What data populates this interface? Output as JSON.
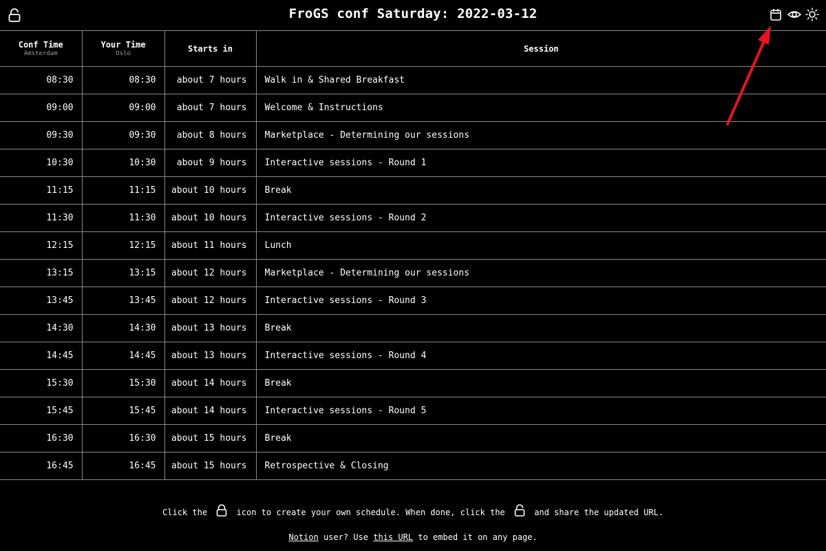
{
  "header": {
    "title": "FroGS conf Saturday: 2022-03-12",
    "icons": [
      "lock-icon",
      "calendar-icon",
      "eye-icon",
      "sun-icon"
    ]
  },
  "table": {
    "columns": {
      "conf_time": "Conf Time",
      "conf_time_sub": "Amsterdam",
      "your_time": "Your Time",
      "your_time_sub": "Oslo",
      "starts_in": "Starts in",
      "session": "Session"
    },
    "rows": [
      {
        "conf": "08:30",
        "your": "08:30",
        "starts": "about 7 hours",
        "session": "Walk in & Shared Breakfast"
      },
      {
        "conf": "09:00",
        "your": "09:00",
        "starts": "about 7 hours",
        "session": "Welcome & Instructions"
      },
      {
        "conf": "09:30",
        "your": "09:30",
        "starts": "about 8 hours",
        "session": "Marketplace - Determining our sessions"
      },
      {
        "conf": "10:30",
        "your": "10:30",
        "starts": "about 9 hours",
        "session": "Interactive sessions - Round 1"
      },
      {
        "conf": "11:15",
        "your": "11:15",
        "starts": "about 10 hours",
        "session": "Break"
      },
      {
        "conf": "11:30",
        "your": "11:30",
        "starts": "about 10 hours",
        "session": "Interactive sessions - Round 2"
      },
      {
        "conf": "12:15",
        "your": "12:15",
        "starts": "about 11 hours",
        "session": "Lunch"
      },
      {
        "conf": "13:15",
        "your": "13:15",
        "starts": "about 12 hours",
        "session": "Marketplace - Determining our sessions"
      },
      {
        "conf": "13:45",
        "your": "13:45",
        "starts": "about 12 hours",
        "session": "Interactive sessions - Round 3"
      },
      {
        "conf": "14:30",
        "your": "14:30",
        "starts": "about 13 hours",
        "session": "Break"
      },
      {
        "conf": "14:45",
        "your": "14:45",
        "starts": "about 13 hours",
        "session": "Interactive sessions - Round 4"
      },
      {
        "conf": "15:30",
        "your": "15:30",
        "starts": "about 14 hours",
        "session": "Break"
      },
      {
        "conf": "15:45",
        "your": "15:45",
        "starts": "about 14 hours",
        "session": "Interactive sessions - Round 5"
      },
      {
        "conf": "16:30",
        "your": "16:30",
        "starts": "about 15 hours",
        "session": "Break"
      },
      {
        "conf": "16:45",
        "your": "16:45",
        "starts": "about 15 hours",
        "session": "Retrospective & Closing"
      }
    ]
  },
  "footer": {
    "line1_a": "Click the",
    "line1_b": "icon to create your own schedule. When done, click the",
    "line1_c": "and share the updated URL.",
    "notion_link": "Notion",
    "line2_a": "user? Use",
    "url_link": "this URL",
    "line2_b": "to embed it on any page."
  },
  "colors": {
    "background": "#000000",
    "text": "#ffffff",
    "border": "#8a8a8a",
    "annotation_arrow": "#e8141c"
  }
}
